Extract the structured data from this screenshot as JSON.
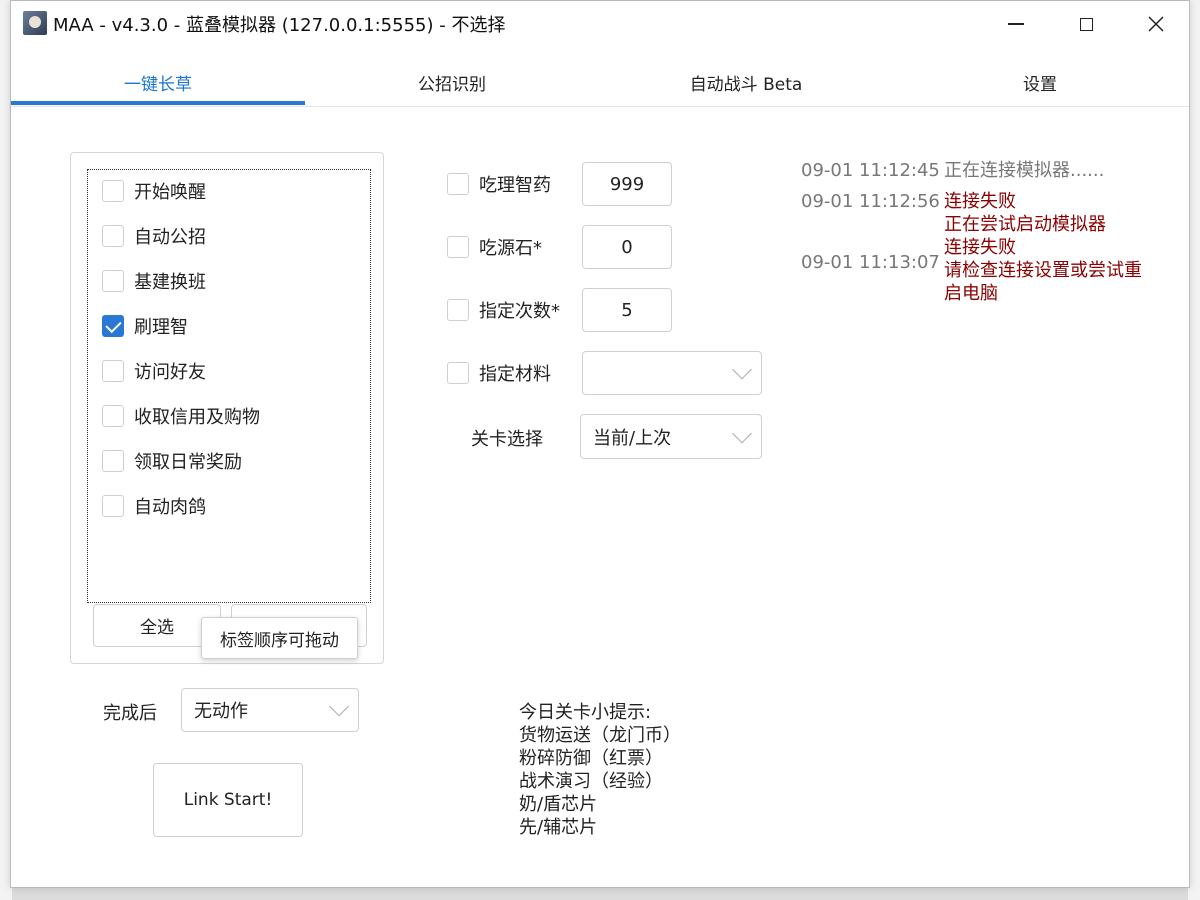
{
  "window": {
    "title": "MAA - v4.3.0 - 蓝叠模拟器 (127.0.0.1:5555) - 不选择"
  },
  "tabs": [
    {
      "label": "一键长草",
      "active": true
    },
    {
      "label": "公招识别",
      "active": false
    },
    {
      "label": "自动战斗 Beta",
      "active": false
    },
    {
      "label": "设置",
      "active": false
    }
  ],
  "tasks": [
    {
      "label": "开始唤醒",
      "checked": false
    },
    {
      "label": "自动公招",
      "checked": false
    },
    {
      "label": "基建换班",
      "checked": false
    },
    {
      "label": "刷理智",
      "checked": true
    },
    {
      "label": "访问好友",
      "checked": false
    },
    {
      "label": "收取信用及购物",
      "checked": false
    },
    {
      "label": "领取日常奖励",
      "checked": false
    },
    {
      "label": "自动肉鸽",
      "checked": false
    }
  ],
  "task_buttons": {
    "select_all": "全选",
    "tooltip": "标签顺序可拖动"
  },
  "after_finish": {
    "label": "完成后",
    "value": "无动作"
  },
  "link_start": "Link Start!",
  "options": [
    {
      "label": "吃理智药",
      "checked": false,
      "value": "999"
    },
    {
      "label": "吃源石*",
      "checked": false,
      "value": "0"
    },
    {
      "label": "指定次数*",
      "checked": false,
      "value": "5"
    },
    {
      "label": "指定材料",
      "checked": false,
      "value": ""
    }
  ],
  "stage": {
    "label": "关卡选择",
    "value": "当前/上次"
  },
  "tips": {
    "title": "今日关卡小提示:",
    "lines": [
      "货物运送（龙门币）",
      "粉碎防御（红票）",
      "战术演习（经验）",
      "奶/盾芯片",
      "先/辅芯片"
    ]
  },
  "log": [
    {
      "time": "09-01  11:12:45",
      "messages": [
        {
          "text": "正在连接模拟器......",
          "color": "#777777"
        }
      ]
    },
    {
      "time": "09-01  11:12:56",
      "messages": [
        {
          "text": "连接失败",
          "color": "#8b0000"
        },
        {
          "text": "正在尝试启动模拟器",
          "color": "#8b0000"
        },
        {
          "text": "连接失败",
          "color": "#8b0000"
        }
      ]
    },
    {
      "time": "09-01  11:13:07",
      "messages": [
        {
          "text": "请检查连接设置或尝试重",
          "color": "#8b0000"
        },
        {
          "text": "启电脑",
          "color": "#8b0000"
        }
      ]
    }
  ],
  "colors": {
    "accent": "#2a78d6",
    "error": "#8b0000",
    "muted": "#777777"
  }
}
